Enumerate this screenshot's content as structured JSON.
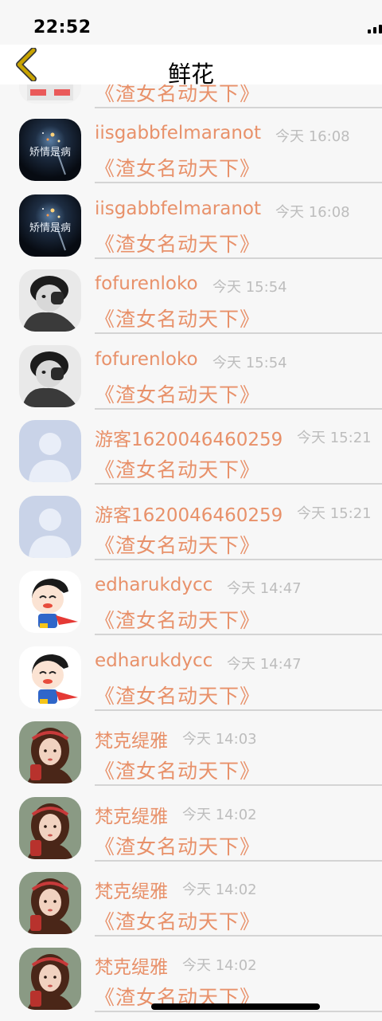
{
  "status_bar": {
    "time": "22:52"
  },
  "header": {
    "title": "鲜花"
  },
  "partial_row": {
    "gift": "《渣女名动天下》"
  },
  "rows": [
    {
      "name": "iisgabbfelmaranot",
      "time": "今天 16:08",
      "gift": "《渣女名动天下》",
      "avatar": "dark-sparkle",
      "avatar_text": "矫情是病"
    },
    {
      "name": "iisgabbfelmaranot",
      "time": "今天 16:08",
      "gift": "《渣女名动天下》",
      "avatar": "dark-sparkle",
      "avatar_text": "矫情是病"
    },
    {
      "name": "fofurenloko",
      "time": "今天 15:54",
      "gift": "《渣女名动天下》",
      "avatar": "bw-child"
    },
    {
      "name": "fofurenloko",
      "time": "今天 15:54",
      "gift": "《渣女名动天下》",
      "avatar": "bw-child"
    },
    {
      "name": "游客1620046460259",
      "time": "今天 15:21",
      "gift": "《渣女名动天下》",
      "avatar": "default-user"
    },
    {
      "name": "游客1620046460259",
      "time": "今天 15:21",
      "gift": "《渣女名动天下》",
      "avatar": "default-user"
    },
    {
      "name": "edharukdycc",
      "time": "今天 14:47",
      "gift": "《渣女名动天下》",
      "avatar": "cartoon-hero"
    },
    {
      "name": "edharukdycc",
      "time": "今天 14:47",
      "gift": "《渣女名动天下》",
      "avatar": "cartoon-hero"
    },
    {
      "name": "梵克缇雅",
      "time": "今天 14:03",
      "gift": "《渣女名动天下》",
      "avatar": "illustrated-girl"
    },
    {
      "name": "梵克缇雅",
      "time": "今天 14:02",
      "gift": "《渣女名动天下》",
      "avatar": "illustrated-girl"
    },
    {
      "name": "梵克缇雅",
      "time": "今天 14:02",
      "gift": "《渣女名动天下》",
      "avatar": "illustrated-girl"
    },
    {
      "name": "梵克缇雅",
      "time": "今天 14:02",
      "gift": "《渣女名动天下》",
      "avatar": "illustrated-girl"
    }
  ],
  "colors": {
    "accent": "#e8916a",
    "muted": "#bdbdbd",
    "back": "#c9a400"
  }
}
